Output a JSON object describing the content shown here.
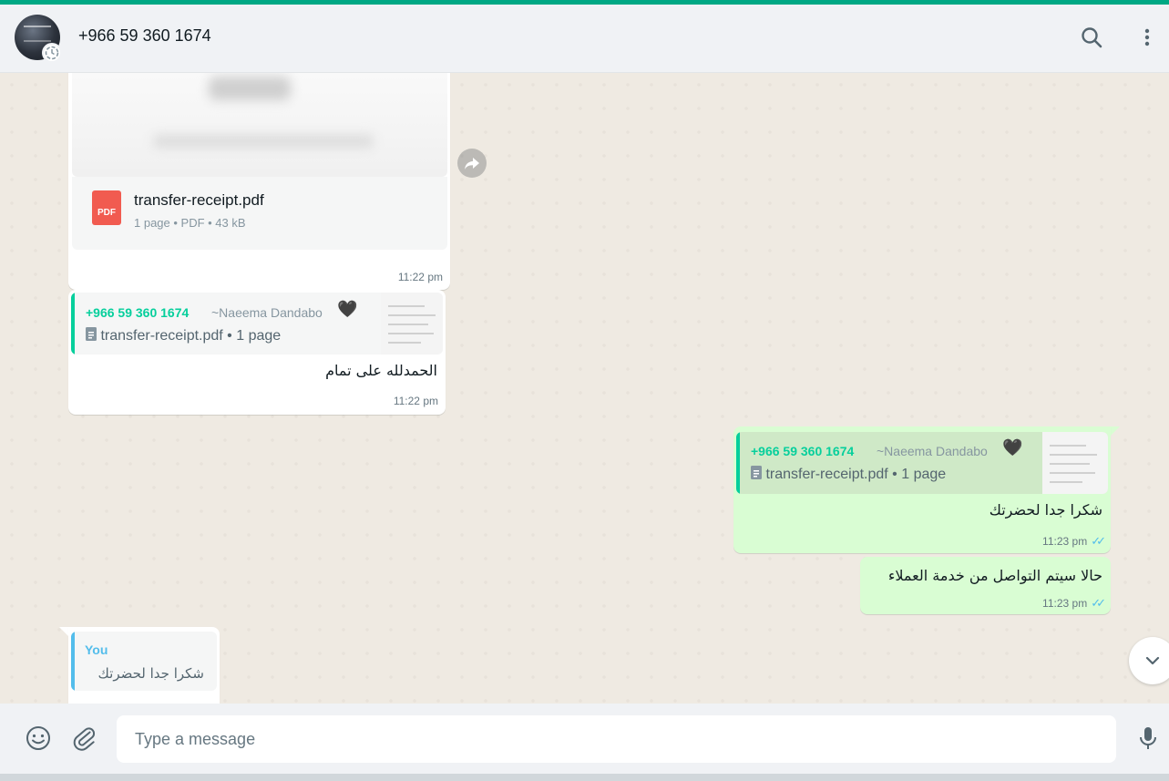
{
  "header": {
    "contact": "+966 59 360 1674"
  },
  "messages": {
    "doc": {
      "file_name": "transfer-receipt.pdf",
      "file_meta": "1 page • PDF • 43 kB",
      "pdf_label": "PDF",
      "time": "11:22 pm"
    },
    "reply1": {
      "quote_phone": "+966 59 360 1674",
      "quote_name": "~Naeema Dandabo",
      "quote_heart": "🖤",
      "quote_file": "transfer-receipt.pdf • 1 page",
      "text": "الحمدلله على تمام",
      "time": "11:22 pm"
    },
    "reply2": {
      "quote_phone": "+966 59 360 1674",
      "quote_name": "~Naeema Dandabo",
      "quote_heart": "🖤",
      "quote_file": "transfer-receipt.pdf • 1 page",
      "text": "شكرا جدا لحضرتك",
      "time": "11:23 pm"
    },
    "out2": {
      "text": "حالا سيتم التواصل من خدمة العملاء",
      "time": "11:23 pm"
    },
    "reply3": {
      "quote_author": "You",
      "quote_text": "شكرا جدا لحضرتك"
    }
  },
  "composer": {
    "placeholder": "Type a message"
  },
  "colors": {
    "accent": "#00a884",
    "outgoing_bubble": "#d9fdd3",
    "read_ticks": "#53bdeb",
    "quote_author": "#06cf9c",
    "self_quote": "#53bdeb"
  },
  "icons": [
    "search-icon",
    "menu-icon",
    "forward-icon",
    "document-icon",
    "double-check-icon",
    "chevron-down-icon",
    "emoji-icon",
    "attach-icon",
    "mic-icon"
  ]
}
